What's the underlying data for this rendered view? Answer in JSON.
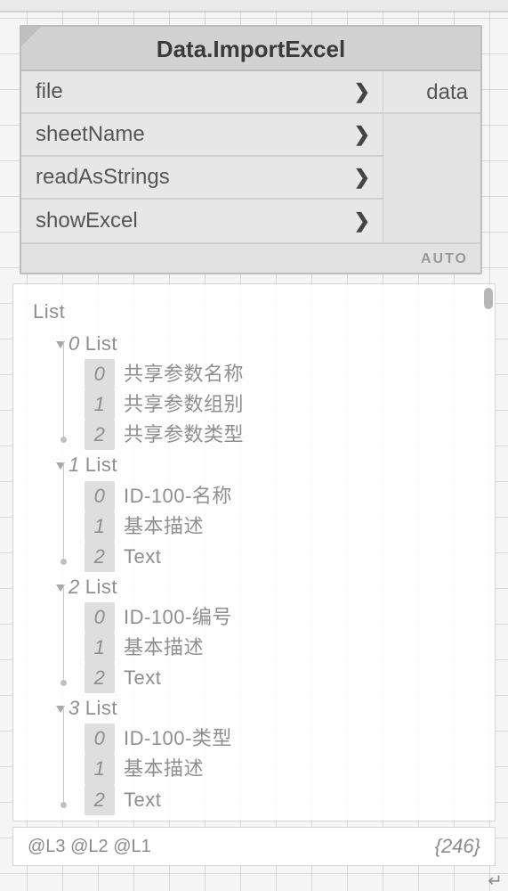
{
  "node": {
    "title": "Data.ImportExcel",
    "inputs": [
      {
        "name": "file"
      },
      {
        "name": "sheetName"
      },
      {
        "name": "readAsStrings"
      },
      {
        "name": "showExcel"
      }
    ],
    "outputs": [
      {
        "name": "data"
      }
    ],
    "lacing": "AUTO"
  },
  "preview": {
    "root_label": "List",
    "lists": [
      {
        "index": "0",
        "label": "List",
        "items": [
          {
            "index": "0",
            "value": "共享参数名称"
          },
          {
            "index": "1",
            "value": "共享参数组别"
          },
          {
            "index": "2",
            "value": "共享参数类型"
          }
        ]
      },
      {
        "index": "1",
        "label": "List",
        "items": [
          {
            "index": "0",
            "value": "ID-100-名称"
          },
          {
            "index": "1",
            "value": "基本描述"
          },
          {
            "index": "2",
            "value": "Text"
          }
        ]
      },
      {
        "index": "2",
        "label": "List",
        "items": [
          {
            "index": "0",
            "value": "ID-100-编号"
          },
          {
            "index": "1",
            "value": "基本描述"
          },
          {
            "index": "2",
            "value": "Text"
          }
        ]
      },
      {
        "index": "3",
        "label": "List",
        "items": [
          {
            "index": "0",
            "value": "ID-100-类型"
          },
          {
            "index": "1",
            "value": "基本描述"
          },
          {
            "index": "2",
            "value": "Text"
          }
        ]
      }
    ]
  },
  "footer": {
    "levels": "@L3 @L2 @L1",
    "count": "{246}"
  }
}
